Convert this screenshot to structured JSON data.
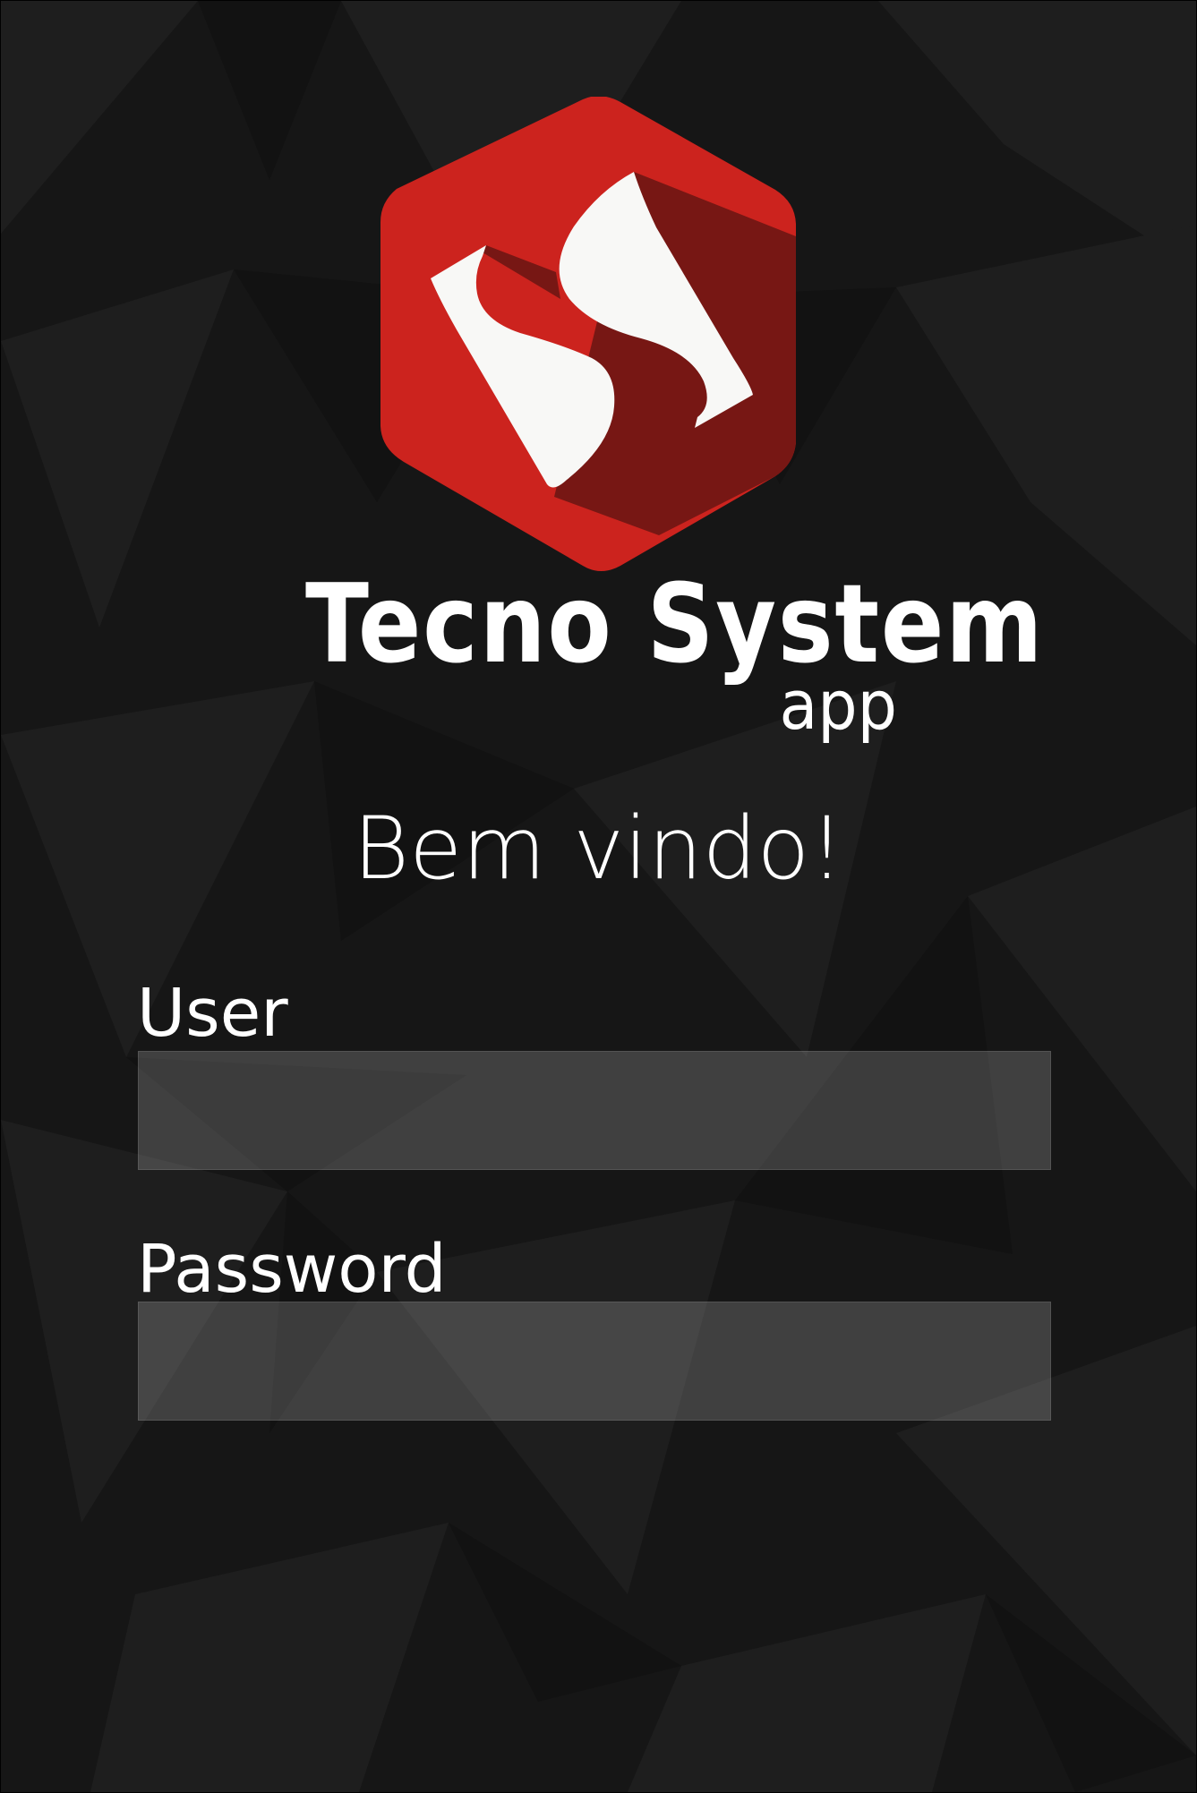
{
  "app": {
    "brand_name": "Tecno System",
    "brand_sub": "app",
    "logo_icon": "hexagon-s-logo",
    "colors": {
      "background": "#161616",
      "logo_red": "#cc231e",
      "logo_dark_red": "#771714",
      "logo_white": "#f8f8f6",
      "input_fill": "#3e3e3e",
      "text": "#ffffff"
    }
  },
  "welcome": "Bem vindo!",
  "form": {
    "user_label": "User",
    "user_value": "",
    "password_label": "Password",
    "password_value": ""
  }
}
